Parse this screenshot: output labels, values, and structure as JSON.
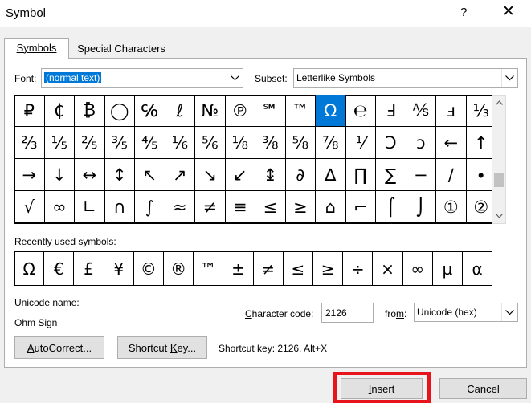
{
  "window": {
    "title": "Symbol",
    "help_glyph": "?",
    "close_glyph": "✕"
  },
  "tabs": [
    {
      "label": "Symbols",
      "active": true
    },
    {
      "label": "Special Characters",
      "active": false
    }
  ],
  "font": {
    "label_prefix": "",
    "label_underlined": "F",
    "label_rest": "ont:",
    "value": "(normal text)"
  },
  "subset": {
    "label_prefix": "S",
    "label_underlined": "u",
    "label_rest": "bset:",
    "value": "Letterlike Symbols"
  },
  "symbol_grid": {
    "rows": [
      [
        "₽",
        "₵",
        "₿",
        "◯",
        "℅",
        "ℓ",
        "№",
        "℗",
        "℠",
        "™",
        "Ω",
        "℮",
        "Ⅎ",
        "⅍",
        "ⅎ",
        "⅓"
      ],
      [
        "⅔",
        "⅕",
        "⅖",
        "⅗",
        "⅘",
        "⅙",
        "⅚",
        "⅛",
        "⅜",
        "⅝",
        "⅞",
        "⅟",
        "Ↄ",
        "ↄ",
        "←",
        "↑"
      ],
      [
        "→",
        "↓",
        "↔",
        "↕",
        "↖",
        "↗",
        "↘",
        "↙",
        "↨",
        "∂",
        "∆",
        "∏",
        "∑",
        "−",
        "∕",
        "∙"
      ],
      [
        "√",
        "∞",
        "∟",
        "∩",
        "∫",
        "≈",
        "≠",
        "≡",
        "≤",
        "≥",
        "⌂",
        "⌐",
        "⌠",
        "⌡",
        "①",
        "②"
      ]
    ],
    "selected": "Ω"
  },
  "recent": {
    "label_underlined": "R",
    "label_rest": "ecently used symbols:",
    "symbols": [
      "Ω",
      "€",
      "£",
      "¥",
      "©",
      "®",
      "™",
      "±",
      "≠",
      "≤",
      "≥",
      "÷",
      "×",
      "∞",
      "µ",
      "α"
    ]
  },
  "unicode": {
    "name_label": "Unicode name:",
    "name_value": "Ohm Sign"
  },
  "character_code": {
    "label_prefix": "",
    "label_underlined": "C",
    "label_rest": "haracter code:",
    "value": "2126"
  },
  "from": {
    "label_prefix": "fro",
    "label_underlined": "m",
    "label_rest": ":",
    "value": "Unicode (hex)"
  },
  "buttons": {
    "autocorrect_prefix": "",
    "autocorrect_underlined": "A",
    "autocorrect_rest": "utoCorrect...",
    "shortcut_prefix": "Shortcut ",
    "shortcut_underlined": "K",
    "shortcut_rest": "ey...",
    "insert_prefix": "",
    "insert_underlined": "I",
    "insert_rest": "nsert",
    "cancel": "Cancel"
  },
  "shortcut_key_text": "Shortcut key: 2126, Alt+X",
  "colors": {
    "selection": "#0078d7",
    "highlight_box": "#e8141c",
    "dialog_bg": "#f0f0f0"
  }
}
